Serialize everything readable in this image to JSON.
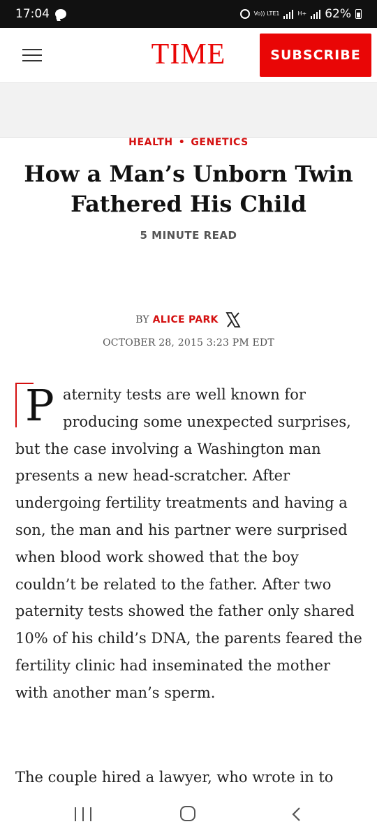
{
  "status_bar": {
    "time": "17:04",
    "network_1": "Vo)) LTE1",
    "network_2": "H+",
    "battery": "62%"
  },
  "header": {
    "logo": "TIME",
    "subscribe_label": "SUBSCRIBE",
    "brand_color": "#e90606"
  },
  "article": {
    "kicker_1": "HEALTH",
    "kicker_sep": "•",
    "kicker_2": "GENETICS",
    "headline": "How a Man’s Unborn Twin Fathered His Child",
    "read_time": "5 MINUTE READ",
    "by": "BY",
    "author": "ALICE PARK",
    "date": "OCTOBER 28, 2015 3:23 PM EDT",
    "dropcap": "P",
    "paragraph_1": "aternity tests are well known for producing some unexpected surprises, but the case involving a Washington man presents a new head-scratcher. After undergoing fertility treatments and having a son, the man and his partner were surprised when blood work showed that the boy couldn’t be related to the father. After two paternity tests showed the father only shared 10% of his child’s DNA, the parents feared the fertility clinic had inseminated the mother with another man’s sperm.",
    "paragraph_2": "The couple hired a lawyer, who wrote in to"
  },
  "icons": {
    "menu": "hamburger-menu-icon",
    "author_social": "x-logo-icon",
    "nav_recents": "recents-icon",
    "nav_home": "home-icon",
    "nav_back": "back-icon"
  }
}
